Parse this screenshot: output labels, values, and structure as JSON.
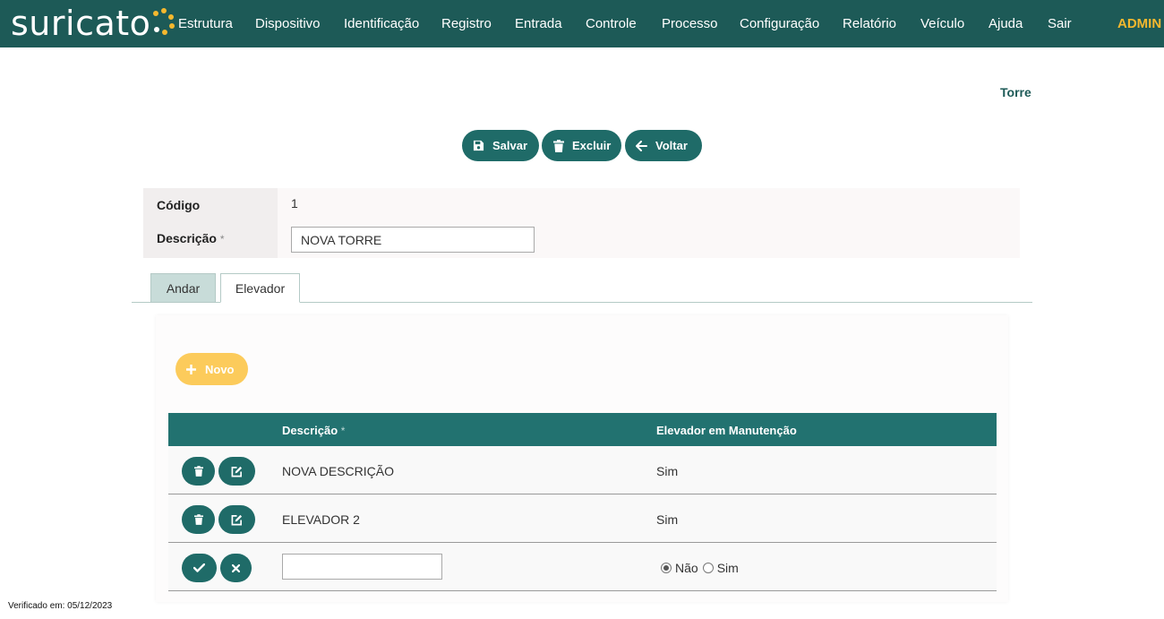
{
  "app": {
    "logo_text": "suricato",
    "nav": [
      {
        "label": "Estrutura"
      },
      {
        "label": "Dispositivo"
      },
      {
        "label": "Identificação"
      },
      {
        "label": "Registro"
      },
      {
        "label": "Entrada"
      },
      {
        "label": "Controle"
      },
      {
        "label": "Processo"
      },
      {
        "label": "Configuração"
      },
      {
        "label": "Relatório"
      },
      {
        "label": "Veículo"
      },
      {
        "label": "Ajuda"
      },
      {
        "label": "Sair"
      }
    ],
    "user": "ADMIN"
  },
  "page": {
    "breadcrumb": "Torre"
  },
  "toolbar": {
    "save_label": "Salvar",
    "delete_label": "Excluir",
    "back_label": "Voltar"
  },
  "form": {
    "codigo_label": "Código",
    "codigo_value": "1",
    "descricao_label": "Descrição",
    "required_mark": "*",
    "descricao_value": "NOVA TORRE"
  },
  "tabs": [
    {
      "label": "Andar",
      "active": false
    },
    {
      "label": "Elevador",
      "active": true
    }
  ],
  "elevador": {
    "novo_label": "Novo",
    "columns": {
      "descricao": "Descrição",
      "required_mark": "*",
      "manutencao": "Elevador em Manutenção"
    },
    "rows": [
      {
        "descricao": "NOVA DESCRIÇÃO",
        "manutencao": "Sim"
      },
      {
        "descricao": "ELEVADOR 2",
        "manutencao": "Sim"
      }
    ],
    "new_row": {
      "descricao_value": "",
      "option_nao": "Não",
      "option_sim": "Sim",
      "selected": "Não"
    }
  },
  "footer": {
    "verified": "Verificado em: 05/12/2023"
  },
  "colors": {
    "brand": "#1d5a57",
    "accent": "#f5b82e",
    "button": "#1f6b68",
    "novo_button": "#fccb5b",
    "table_header": "#227270"
  }
}
